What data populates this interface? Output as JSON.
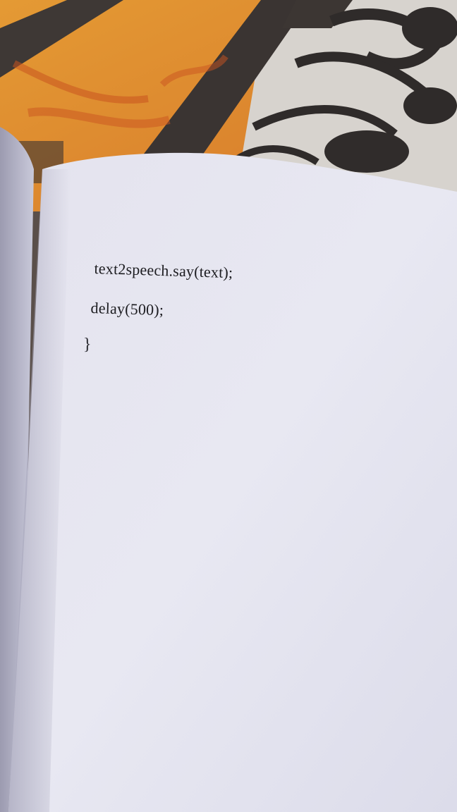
{
  "photo": {
    "subject": "open book page",
    "colors": {
      "cloth_orange": "#e8962a",
      "cloth_dark": "#3b3634",
      "cloth_light": "#d9d5d0",
      "page": "#e6e6f0",
      "ink": "#1d1d21"
    }
  },
  "code": {
    "line1": "text2speech.say(text);",
    "line2": "delay(500);",
    "line3": "}"
  }
}
